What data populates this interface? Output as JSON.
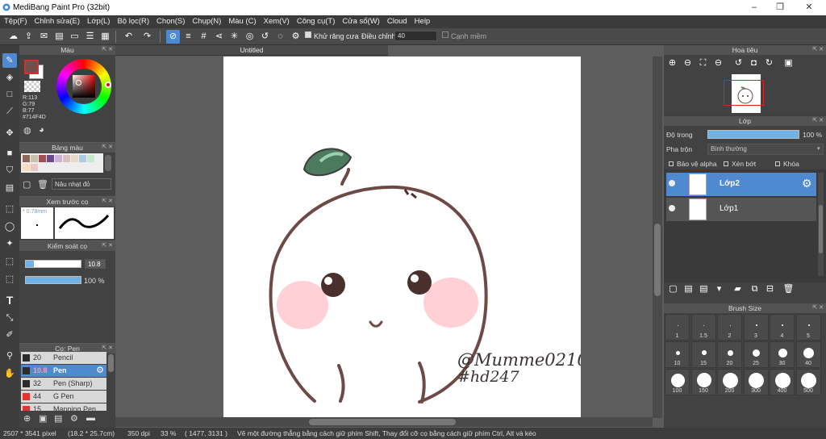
{
  "window": {
    "title": "MediBang Paint Pro (32bit)",
    "min": "–",
    "max": "❐",
    "close": "✕"
  },
  "menu": [
    "Tệp(F)",
    "Chỉnh sửa(E)",
    "Lớp(L)",
    "Bộ lọc(R)",
    "Chọn(S)",
    "Chụp(N)",
    "Màu (C)",
    "Xem(V)",
    "Công cụ(T)",
    "Cửa sổ(W)",
    "Cloud",
    "Help"
  ],
  "toolbar": {
    "antialias_label": "Khử răng cưa",
    "correction_label": "Điều chỉnh",
    "correction_value": "40",
    "smooth_label": "Cạnh mềm"
  },
  "color_panel": {
    "title": "Màu",
    "r": "R:113",
    "g": "G:79",
    "b": "B:77",
    "hex": "#714F4D",
    "main_color": "#714f4d"
  },
  "palette_panel": {
    "title": "Bảng màu",
    "color_name": "Nâu nhạt đỏ",
    "swatches": [
      "#8a6a5a",
      "#c9c0b0",
      "#a05050",
      "#6b4c8a",
      "#c9b4d8",
      "#d8c0c0",
      "#e8d8c8",
      "#b0c8e0",
      "#c8e8d0",
      "#f0f0f0",
      "#f4e0c0",
      "#e8c8c8"
    ]
  },
  "brush_preview": {
    "title": "Xem trước cọ",
    "size": "0.78mm"
  },
  "brush_control": {
    "title": "Kiểm soát cọ",
    "size": "10.8",
    "opacity": "100 %",
    "size_fraction": 0.15,
    "opacity_fraction": 1.0
  },
  "brush_list": {
    "title": "Cọ: Pen",
    "items": [
      {
        "size": "20",
        "name": "Pencil",
        "color": "#2c2c2c"
      },
      {
        "size": "10.8",
        "name": "Pen",
        "color": "#2c2c2c",
        "selected": true
      },
      {
        "size": "32",
        "name": "Pen (Sharp)",
        "color": "#2c2c2c"
      },
      {
        "size": "44",
        "name": "G Pen",
        "color": "#e53333"
      },
      {
        "size": "15",
        "name": "Mapping Pen",
        "color": "#e53333"
      }
    ]
  },
  "document": {
    "tab": "Untitled",
    "watermark1": "@Mumme0210",
    "watermark2": "#hd247"
  },
  "navigator": {
    "title": "Hoa tiêu"
  },
  "layer_panel": {
    "title": "Lớp",
    "opacity_label": "Độ trong",
    "opacity_value": "100 %",
    "opacity_fraction": 1.0,
    "blend_label": "Pha trộn",
    "blend_value": "Bình thường",
    "protect_alpha": "Bảo vệ alpha",
    "clip": "Xén bớt",
    "lock": "Khóa",
    "layers": [
      {
        "name": "Lớp2",
        "selected": true
      },
      {
        "name": "Lớp1",
        "selected": false
      }
    ]
  },
  "brush_size_panel": {
    "title": "Brush Size",
    "sizes": [
      "1",
      "1.5",
      "2",
      "3",
      "4",
      "5",
      "10",
      "15",
      "20",
      "25",
      "30",
      "40",
      "100",
      "150",
      "200",
      "300",
      "400",
      "500"
    ]
  },
  "status": {
    "size": "2507 * 3541 pixel",
    "cm": "(18.2 * 25.7cm)",
    "dpi": "350 dpi",
    "zoom": "33 %",
    "coords": "( 1477, 3131 )",
    "hint": "Vẽ một đường thẳng bằng cách giữ phím Shift, Thay đổi cỡ cọ bằng cách giữ phím Ctrl, Alt và kéo"
  }
}
